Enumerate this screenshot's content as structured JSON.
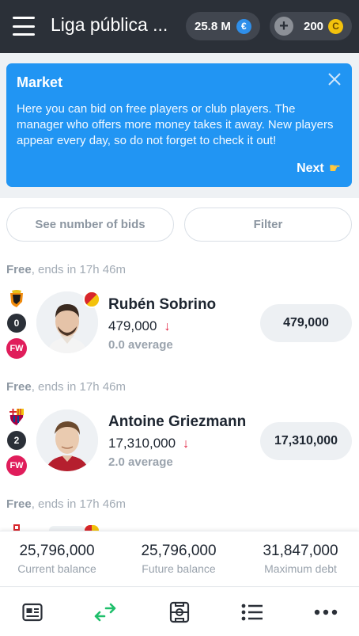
{
  "header": {
    "league_name": "Liga pública ...",
    "balance": "25.8 M",
    "coins": "200",
    "currency_icon": "euro-coin-icon",
    "coin_icon": "gold-coin-icon"
  },
  "banner": {
    "title": "Market",
    "text": "Here you can bid on free players or club players. The manager who offers more money takes it away. New players appear every day, so do not forget to check it out!",
    "next_label": "Next",
    "next_icon": "pointing-hand-icon"
  },
  "actions": {
    "bids_label": "See number of bids",
    "filter_label": "Filter"
  },
  "players": [
    {
      "status": "Free",
      "ends": ", ends in 17h 46m",
      "team_icon": "valencia-crest-icon",
      "bids": "0",
      "position": "FW",
      "name": "Rubén Sobrino",
      "value": "479,000",
      "trend": "↓",
      "average": "0.0 average",
      "bid": "479,000"
    },
    {
      "status": "Free",
      "ends": ", ends in 17h 46m",
      "team_icon": "barcelona-crest-icon",
      "bids": "2",
      "position": "FW",
      "name": "Antoine Griezmann",
      "value": "17,310,000",
      "trend": "↓",
      "average": "2.0 average",
      "bid": "17,310,000"
    },
    {
      "status": "Free",
      "ends": ", ends in 17h 46m"
    }
  ],
  "balances": {
    "current_value": "25,796,000",
    "current_label": "Current balance",
    "future_value": "25,796,000",
    "future_label": "Future balance",
    "debt_value": "31,847,000",
    "debt_label": "Maximum debt"
  },
  "nav": [
    "news-icon",
    "market-transfer-icon",
    "lineup-field-icon",
    "standings-list-icon",
    "more-dots-icon"
  ],
  "colors": {
    "header_bg": "#2b3038",
    "banner_bg": "#2195f3",
    "position_badge": "#e01d5b",
    "trend_down": "#e01d3d",
    "active_nav": "#1fbf6b"
  }
}
